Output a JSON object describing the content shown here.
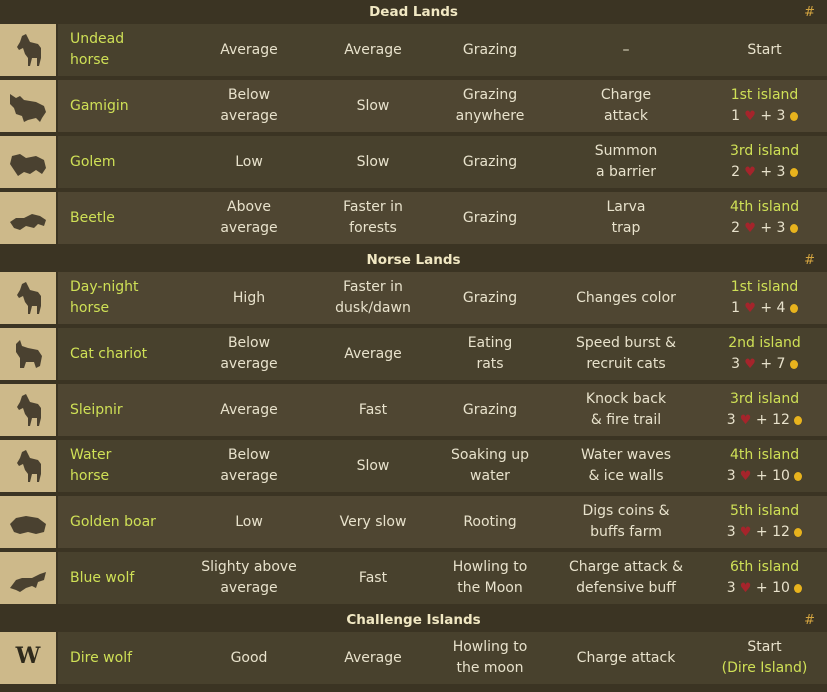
{
  "sections": [
    {
      "title": "Dead Lands",
      "hash": "#",
      "mounts": [
        {
          "icon": "horse-icon",
          "name_l1": "Undead",
          "name_l2": "horse",
          "speed_l1": "Average",
          "speed_l2": "",
          "terrain_l1": "Average",
          "terrain_l2": "",
          "eat_l1": "Grazing",
          "eat_l2": "",
          "ability_l1": "–",
          "ability_l2": "",
          "unlock_l1": "Start",
          "unlock_hearts": "",
          "unlock_coins": ""
        },
        {
          "icon": "gamigin-icon",
          "name_l1": "Gamigin",
          "name_l2": "",
          "speed_l1": "Below",
          "speed_l2": "average",
          "terrain_l1": "Slow",
          "terrain_l2": "",
          "eat_l1": "Grazing",
          "eat_l2": "anywhere",
          "ability_l1": "Charge",
          "ability_l2": "attack",
          "unlock_l1": "1st island",
          "unlock_hearts": "1",
          "unlock_coins": "3"
        },
        {
          "icon": "golem-icon",
          "name_l1": "Golem",
          "name_l2": "",
          "speed_l1": "Low",
          "speed_l2": "",
          "terrain_l1": "Slow",
          "terrain_l2": "",
          "eat_l1": "Grazing",
          "eat_l2": "",
          "ability_l1": "Summon",
          "ability_l2": "a barrier",
          "unlock_l1": "3rd island",
          "unlock_hearts": "2",
          "unlock_coins": "3"
        },
        {
          "icon": "beetle-icon",
          "name_l1": "Beetle",
          "name_l2": "",
          "speed_l1": "Above",
          "speed_l2": "average",
          "terrain_l1": "Faster in",
          "terrain_l2": "forests",
          "eat_l1": "Grazing",
          "eat_l2": "",
          "ability_l1": "Larva",
          "ability_l2": "trap",
          "unlock_l1": "4th island",
          "unlock_hearts": "2",
          "unlock_coins": "3"
        }
      ]
    },
    {
      "title": "Norse Lands",
      "hash": "#",
      "mounts": [
        {
          "icon": "horse-icon",
          "name_l1": "Day-night",
          "name_l2": "horse",
          "speed_l1": "High",
          "speed_l2": "",
          "terrain_l1": "Faster in",
          "terrain_l2": "dusk/dawn",
          "eat_l1": "Grazing",
          "eat_l2": "",
          "ability_l1": "Changes color",
          "ability_l2": "",
          "unlock_l1": "1st island",
          "unlock_hearts": "1",
          "unlock_coins": "4"
        },
        {
          "icon": "cat-icon",
          "name_l1": "Cat chariot",
          "name_l2": "",
          "speed_l1": "Below",
          "speed_l2": "average",
          "terrain_l1": "Average",
          "terrain_l2": "",
          "eat_l1": "Eating",
          "eat_l2": "rats",
          "ability_l1": "Speed burst &",
          "ability_l2": "recruit cats",
          "unlock_l1": "2nd island",
          "unlock_hearts": "3",
          "unlock_coins": "7"
        },
        {
          "icon": "horse-icon",
          "name_l1": "Sleipnir",
          "name_l2": "",
          "speed_l1": "Average",
          "speed_l2": "",
          "terrain_l1": "Fast",
          "terrain_l2": "",
          "eat_l1": "Grazing",
          "eat_l2": "",
          "ability_l1": "Knock back",
          "ability_l2": "& fire trail",
          "unlock_l1": "3rd island",
          "unlock_hearts": "3",
          "unlock_coins": "12"
        },
        {
          "icon": "horse-icon",
          "name_l1": "Water",
          "name_l2": "horse",
          "speed_l1": "Below",
          "speed_l2": "average",
          "terrain_l1": "Slow",
          "terrain_l2": "",
          "eat_l1": "Soaking up",
          "eat_l2": "water",
          "ability_l1": "Water waves",
          "ability_l2": "& ice walls",
          "unlock_l1": "4th island",
          "unlock_hearts": "3",
          "unlock_coins": "10"
        },
        {
          "icon": "boar-icon",
          "name_l1": "Golden boar",
          "name_l2": "",
          "speed_l1": "Low",
          "speed_l2": "",
          "terrain_l1": "Very slow",
          "terrain_l2": "",
          "eat_l1": "Rooting",
          "eat_l2": "",
          "ability_l1": "Digs coins &",
          "ability_l2": "buffs farm",
          "unlock_l1": "5th island",
          "unlock_hearts": "3",
          "unlock_coins": "12"
        },
        {
          "icon": "wolf-icon",
          "name_l1": "Blue wolf",
          "name_l2": "",
          "speed_l1": "Slighty above",
          "speed_l2": "average",
          "terrain_l1": "Fast",
          "terrain_l2": "",
          "eat_l1": "Howling to",
          "eat_l2": "the Moon",
          "ability_l1": "Charge attack &",
          "ability_l2": "defensive buff",
          "unlock_l1": "6th island",
          "unlock_hearts": "3",
          "unlock_coins": "10"
        }
      ]
    },
    {
      "title": "Challenge Islands",
      "hash": "#",
      "mounts": [
        {
          "icon": "w-logo-icon",
          "icon_text": "W",
          "name_l1": "Dire wolf",
          "name_l2": "",
          "speed_l1": "Good",
          "speed_l2": "",
          "terrain_l1": "Average",
          "terrain_l2": "",
          "eat_l1": "Howling to",
          "eat_l2": "the moon",
          "ability_l1": "Charge attack",
          "ability_l2": "",
          "unlock_l1": "Start",
          "unlock_paren": "(Dire Island)",
          "unlock_hearts": "",
          "unlock_coins": ""
        }
      ]
    }
  ]
}
